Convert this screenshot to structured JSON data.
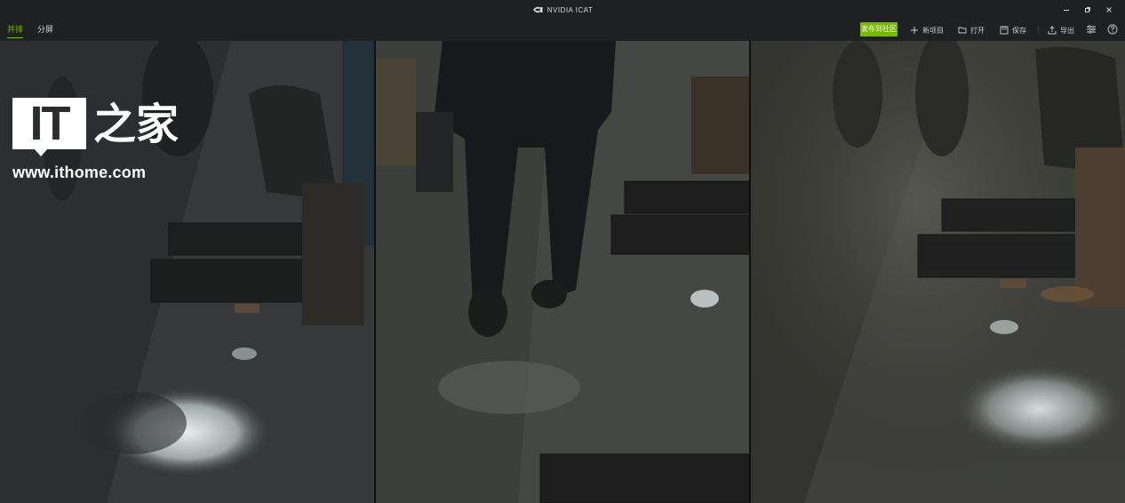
{
  "window": {
    "title": "NVIDIA ICAT",
    "controls": [
      "minimize-icon",
      "restore-icon",
      "close-icon"
    ]
  },
  "toolbar": {
    "tabs": [
      {
        "label": "并排",
        "active": true
      },
      {
        "label": "分屏",
        "active": false
      }
    ],
    "export_label": "发布到社区",
    "actions": [
      {
        "icon": "plus-icon",
        "label": "新项目"
      },
      {
        "icon": "folder-icon",
        "label": "打开"
      },
      {
        "icon": "save-icon",
        "label": "保存"
      },
      {
        "icon": "export-icon",
        "label": "导出"
      }
    ],
    "icon_buttons": [
      "settings-icon",
      "help-icon"
    ]
  },
  "watermark": {
    "logo_text": "IT",
    "logo_cn": "之家",
    "url": "www.ithome.com"
  },
  "colors": {
    "accent": "#76b900",
    "chrome": "#1f2021"
  }
}
